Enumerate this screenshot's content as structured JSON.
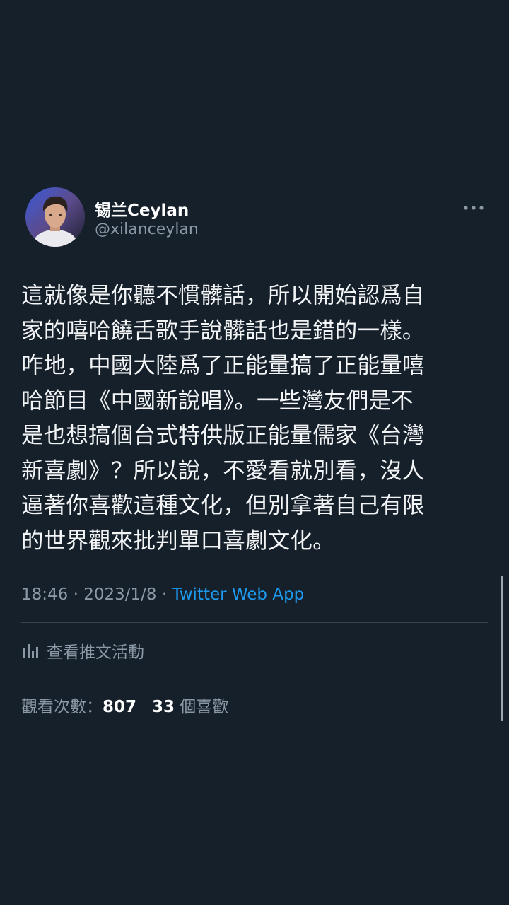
{
  "author": {
    "display_name": "锡兰Ceylan",
    "handle": "@xilanceylan"
  },
  "tweet": {
    "lines": [
      "這就像是你聽不慣髒話，所以開始認爲自",
      "家的嘻哈饒舌歌手說髒話也是錯的一樣。",
      "咋地，中國大陸爲了正能量搞了正能量嘻",
      "哈節目《中國新說唱》。一些灣友們是不",
      "是也想搞個台式特供版正能量儒家《台灣",
      "新喜劇》？所以說，不愛看就別看，沒人",
      "逼著你喜歡這種文化，但別拿著自己有限",
      "的世界觀來批判單口喜劇文化。"
    ],
    "time": "18:46",
    "separator": "·",
    "date": "2023/1/8",
    "source": "Twitter Web App"
  },
  "activity": {
    "label": "查看推文活動",
    "icon": "analytics-icon"
  },
  "stats": {
    "views_label": "觀看次數：",
    "views_count": "807",
    "likes_count": "33",
    "likes_label": "個喜歡"
  },
  "colors": {
    "background": "#15202b",
    "text": "#ffffff",
    "secondary": "#8b98a5",
    "link": "#1d9bf0",
    "divider": "#38444d"
  }
}
